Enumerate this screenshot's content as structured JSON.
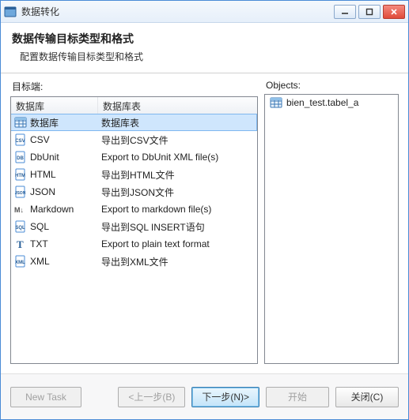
{
  "window": {
    "title": "数据转化"
  },
  "header": {
    "title": "数据传输目标类型和格式",
    "subtitle": "配置数据传输目标类型和格式"
  },
  "targets": {
    "label": "目标端:",
    "columns": {
      "name": "数据库",
      "desc": "数据库表"
    },
    "rows": [
      {
        "icon": "table-icon",
        "name": "数据库",
        "desc": "数据库表",
        "selected": true
      },
      {
        "icon": "csv-icon",
        "name": "CSV",
        "desc": "导出到CSV文件"
      },
      {
        "icon": "dbunit-icon",
        "name": "DbUnit",
        "desc": "Export to DbUnit XML file(s)"
      },
      {
        "icon": "html-icon",
        "name": "HTML",
        "desc": "导出到HTML文件"
      },
      {
        "icon": "json-icon",
        "name": "JSON",
        "desc": "导出到JSON文件"
      },
      {
        "icon": "markdown-icon",
        "name": "Markdown",
        "desc": "Export to markdown file(s)"
      },
      {
        "icon": "sql-icon",
        "name": "SQL",
        "desc": "导出到SQL INSERT语句"
      },
      {
        "icon": "txt-icon",
        "name": "TXT",
        "desc": "Export to plain text format"
      },
      {
        "icon": "xml-icon",
        "name": "XML",
        "desc": "导出到XML文件"
      }
    ]
  },
  "objects": {
    "label": "Objects:",
    "items": [
      {
        "icon": "table-icon",
        "name": "bien_test.tabel_a"
      }
    ]
  },
  "buttons": {
    "new_task": "New Task",
    "back": "<上一步(B)",
    "next": "下一步(N)>",
    "start": "开始",
    "close": "关闭(C)"
  },
  "icon_glyphs": {
    "csv": "CSV",
    "html": "HTM",
    "json": "JSON",
    "markdown": "M↓",
    "sql": "SQL",
    "txt": "T",
    "xml": "XML",
    "dbunit": "DB"
  },
  "colors": {
    "accent": "#3c7fb1",
    "select_bg": "#cfe6fd"
  }
}
